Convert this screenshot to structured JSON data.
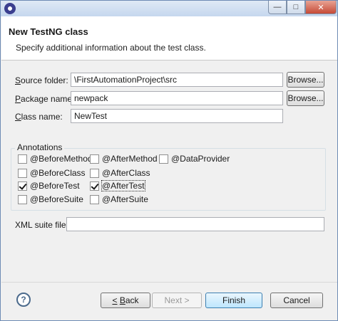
{
  "window": {
    "minimize": "—",
    "maximize": "□",
    "close": "✕"
  },
  "banner": {
    "title": "New TestNG class",
    "description": "Specify additional information about the test class."
  },
  "form": {
    "source_folder": {
      "label_first": "S",
      "label_rest": "ource folder:",
      "value": "\\FirstAutomationProject\\src",
      "browse": "Browse..."
    },
    "package_name": {
      "label_first": "P",
      "label_rest": "ackage name:",
      "value": "newpack",
      "browse": "Browse..."
    },
    "class_name": {
      "label_first": "C",
      "label_rest": "lass name:",
      "value": "NewTest"
    }
  },
  "annotations": {
    "title": "Annotations",
    "items": [
      {
        "label": "@BeforeMethod",
        "checked": false
      },
      {
        "label": "@AfterMethod",
        "checked": false
      },
      {
        "label": "@DataProvider",
        "checked": false
      },
      {
        "label": "@BeforeClass",
        "checked": false
      },
      {
        "label": "@AfterClass",
        "checked": false
      },
      {
        "label": "@BeforeTest",
        "checked": true
      },
      {
        "label": "@AfterTest",
        "checked": true
      },
      {
        "label": "@BeforeSuite",
        "checked": false
      },
      {
        "label": "@AfterSuite",
        "checked": false
      }
    ]
  },
  "xml_suite": {
    "label": "XML suite file:",
    "value": ""
  },
  "footer": {
    "help": "?",
    "back": "< Back",
    "next": "Next >",
    "finish": "Finish",
    "cancel": "Cancel"
  }
}
